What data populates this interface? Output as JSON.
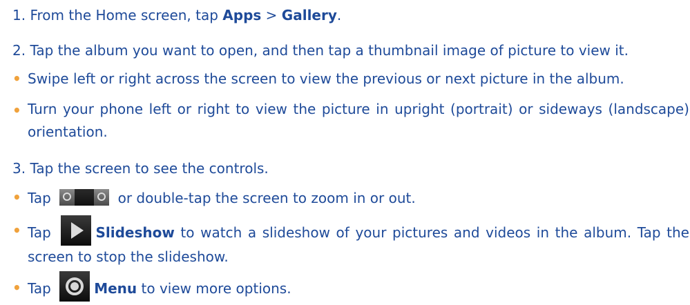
{
  "step1": {
    "prefix": "1. From the Home screen, tap ",
    "apps": "Apps",
    "sep": " > ",
    "gallery": "Gallery",
    "suffix": "."
  },
  "step2": {
    "text": "2. Tap the album you want to open, and then tap a thumbnail image of picture to view it."
  },
  "bullet_swipe": "Swipe left or right across the screen to view the previous or next picture in the album.",
  "bullet_turn": "Turn your phone left or right to view the picture in upright (portrait) or sideways (landscape) orientation.",
  "step3": {
    "text": "3. Tap the screen to see the controls."
  },
  "bullet_zoom": {
    "prefix": "Tap",
    "suffix": "or double-tap the screen to zoom in or out."
  },
  "bullet_slideshow": {
    "prefix": "Tap",
    "label": "Slideshow",
    "suffix": " to watch a slideshow of your pictures and videos in the album. Tap the screen to stop the slideshow."
  },
  "bullet_menu": {
    "prefix": "Tap",
    "label": "Menu",
    "suffix": " to view more options."
  },
  "bullet_char": "•",
  "icons": {
    "zoom": "zoom-icon",
    "slideshow": "play-icon",
    "menu": "menu-icon"
  },
  "colors": {
    "text": "#1e4a99",
    "bullet": "#f0a23c"
  }
}
